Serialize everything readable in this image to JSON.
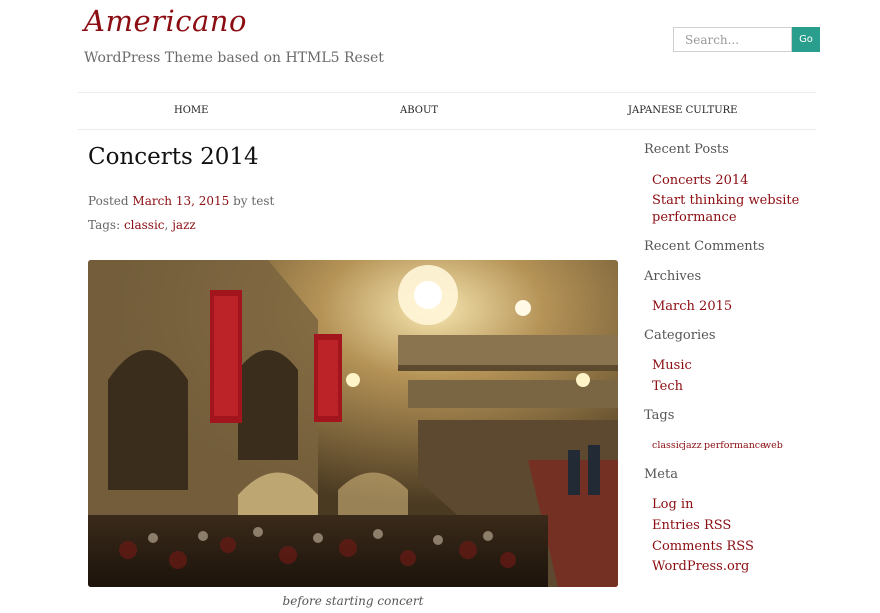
{
  "header": {
    "site_title": "Americano",
    "tagline": "WordPress Theme based on HTML5 Reset",
    "search_placeholder": "Search...",
    "search_button": "Go"
  },
  "nav": {
    "items": [
      {
        "label": "HOME"
      },
      {
        "label": "ABOUT"
      },
      {
        "label": "JAPANESE CULTURE"
      }
    ]
  },
  "post": {
    "title": "Concerts 2014",
    "posted_prefix": "Posted",
    "date": "March 13, 2015",
    "by_prefix": "by",
    "author": "test",
    "tags_prefix": "Tags:",
    "tags": [
      "classic",
      "jazz"
    ],
    "tag_separator": ",",
    "image_caption": "before starting concert"
  },
  "sidebar": {
    "recent_posts_title": "Recent Posts",
    "recent_posts": [
      {
        "label": "Concerts 2014"
      },
      {
        "label": "Start thinking website performance"
      }
    ],
    "recent_comments_title": "Recent Comments",
    "archives_title": "Archives",
    "archives": [
      {
        "label": "March 2015"
      }
    ],
    "categories_title": "Categories",
    "categories": [
      {
        "label": "Music"
      },
      {
        "label": "Tech"
      }
    ],
    "tags_title": "Tags",
    "tags": [
      {
        "label": "classic"
      },
      {
        "label": "jazz"
      },
      {
        "label": "performance"
      },
      {
        "label": "web"
      }
    ],
    "meta_title": "Meta",
    "meta": [
      {
        "label": "Log in"
      },
      {
        "label": "Entries RSS"
      },
      {
        "label": "Comments RSS"
      },
      {
        "label": "WordPress.org"
      }
    ]
  },
  "colors": {
    "accent": "#8b0d12",
    "button": "#2a9e8c",
    "text": "#333333"
  }
}
